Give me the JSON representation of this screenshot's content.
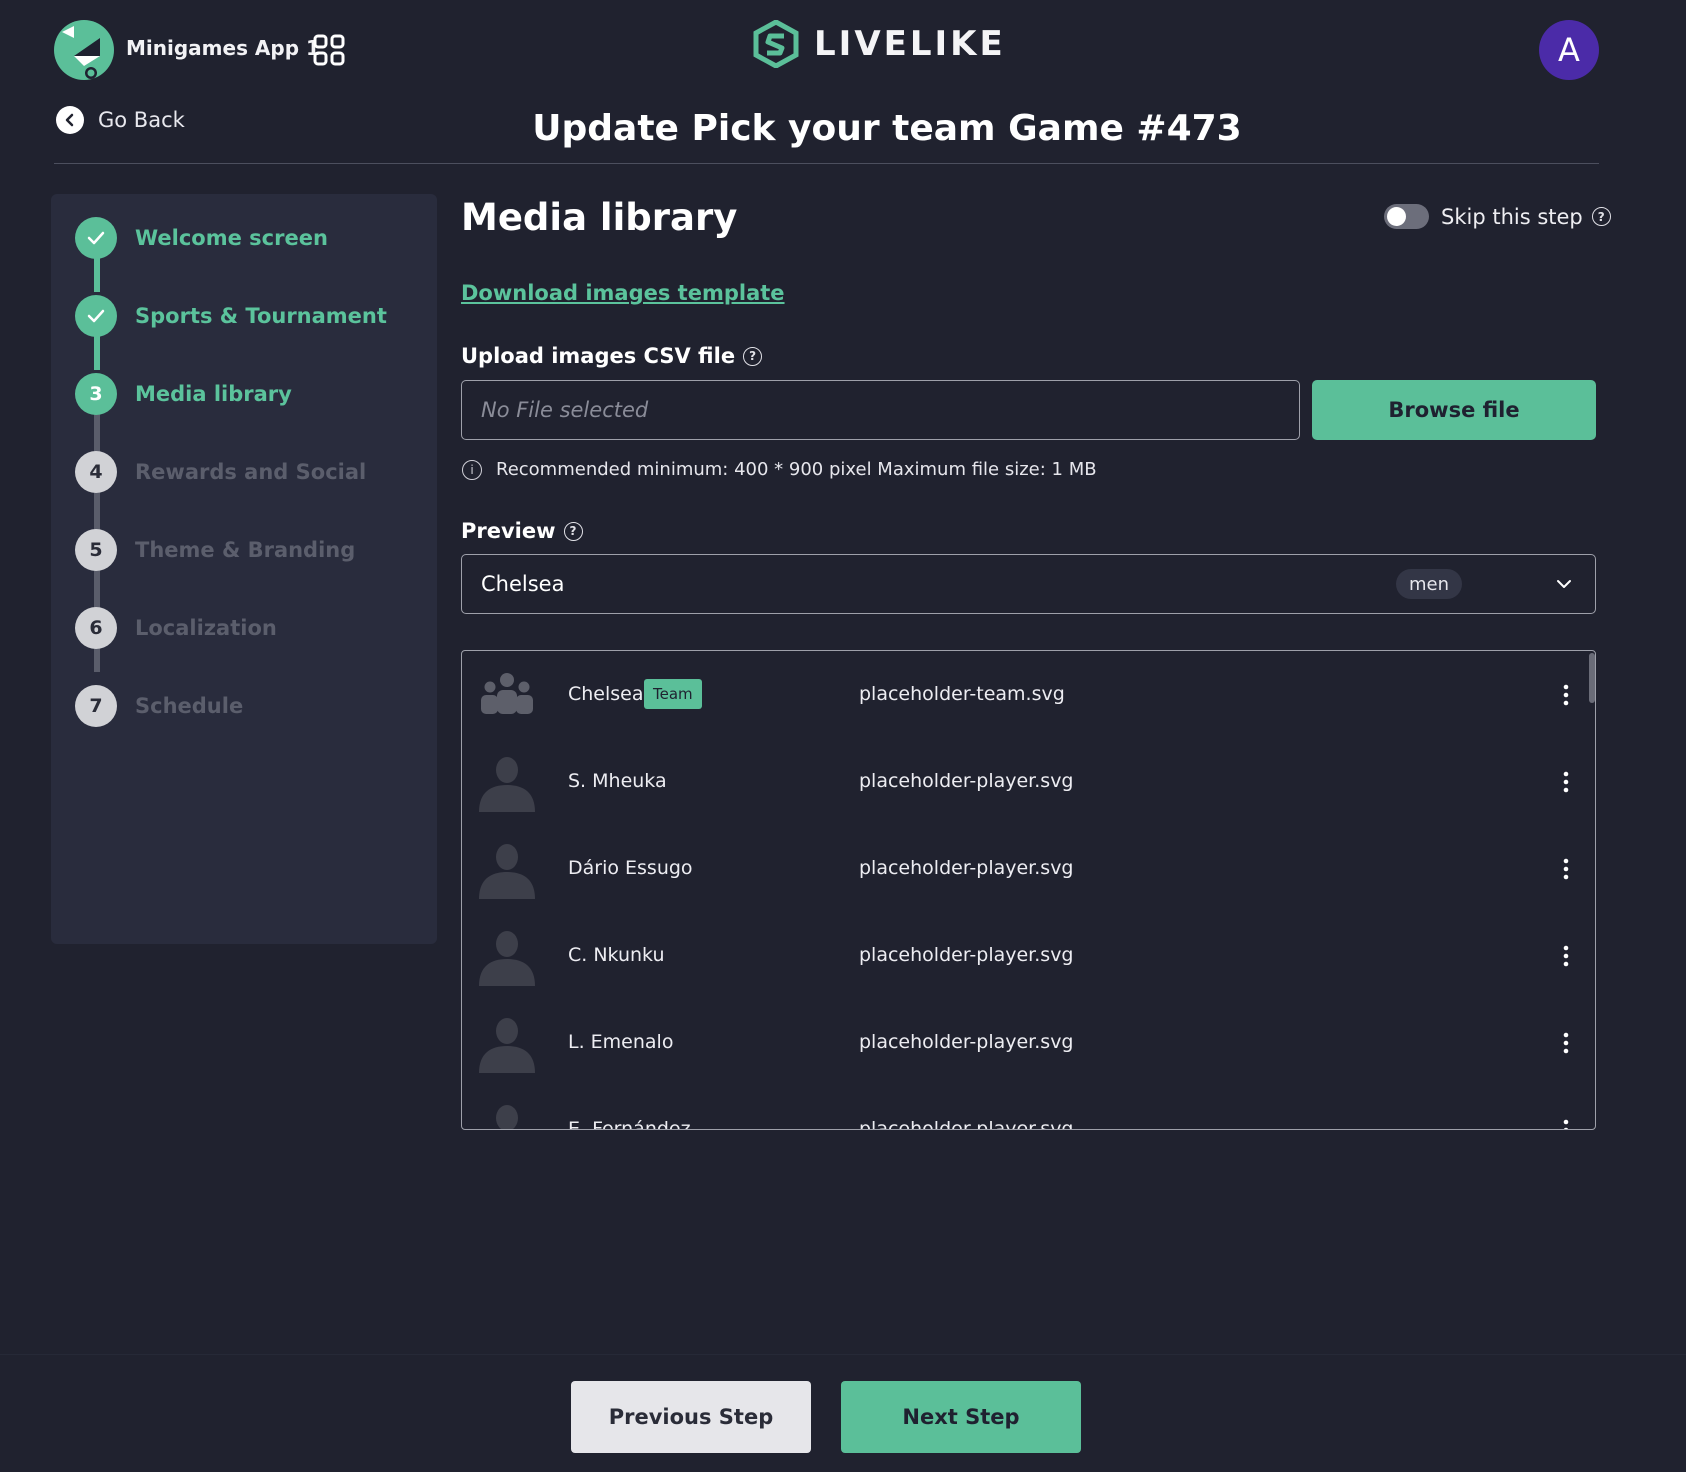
{
  "header": {
    "app_name": "Minigames App 1",
    "brand_name": "LIVELIKE",
    "avatar_initial": "A",
    "go_back_label": "Go Back",
    "page_title": "Update Pick your team Game #473"
  },
  "sidebar": {
    "steps": [
      {
        "number": "1",
        "label": "Welcome screen",
        "state": "done"
      },
      {
        "number": "2",
        "label": "Sports & Tournament",
        "state": "done"
      },
      {
        "number": "3",
        "label": "Media library",
        "state": "active"
      },
      {
        "number": "4",
        "label": "Rewards and Social",
        "state": "todo"
      },
      {
        "number": "5",
        "label": "Theme & Branding",
        "state": "todo"
      },
      {
        "number": "6",
        "label": "Localization",
        "state": "todo"
      },
      {
        "number": "7",
        "label": "Schedule",
        "state": "todo"
      }
    ]
  },
  "main": {
    "section_title": "Media library",
    "skip_label": "Skip this step",
    "skip_enabled": false,
    "download_link": "Download images template",
    "upload_label": "Upload images CSV file",
    "file_placeholder": "No File selected",
    "browse_label": "Browse file",
    "recommendation": "Recommended minimum: 400 * 900 pixel Maximum file size: 1 MB",
    "preview_label": "Preview",
    "preview_selected": "Chelsea",
    "preview_badge": "men",
    "media_rows": [
      {
        "name": "Chelsea",
        "tag": "Team",
        "file": "placeholder-team.svg",
        "icon": "team-placeholder-icon"
      },
      {
        "name": "S. Mheuka",
        "tag": "",
        "file": "placeholder-player.svg",
        "icon": "player-placeholder-icon"
      },
      {
        "name": "Dário Essugo",
        "tag": "",
        "file": "placeholder-player.svg",
        "icon": "player-placeholder-icon"
      },
      {
        "name": "C. Nkunku",
        "tag": "",
        "file": "placeholder-player.svg",
        "icon": "player-placeholder-icon"
      },
      {
        "name": "L. Emenalo",
        "tag": "",
        "file": "placeholder-player.svg",
        "icon": "player-placeholder-icon"
      },
      {
        "name": "E. Fernández",
        "tag": "",
        "file": "placeholder-player.svg",
        "icon": "player-placeholder-icon"
      }
    ]
  },
  "footer": {
    "previous_label": "Previous Step",
    "next_label": "Next Step"
  },
  "colors": {
    "background": "#20222f",
    "accent": "#5bbf99",
    "sidebar_bg": "#292c3d",
    "avatar_bg": "#4b2ba8"
  }
}
